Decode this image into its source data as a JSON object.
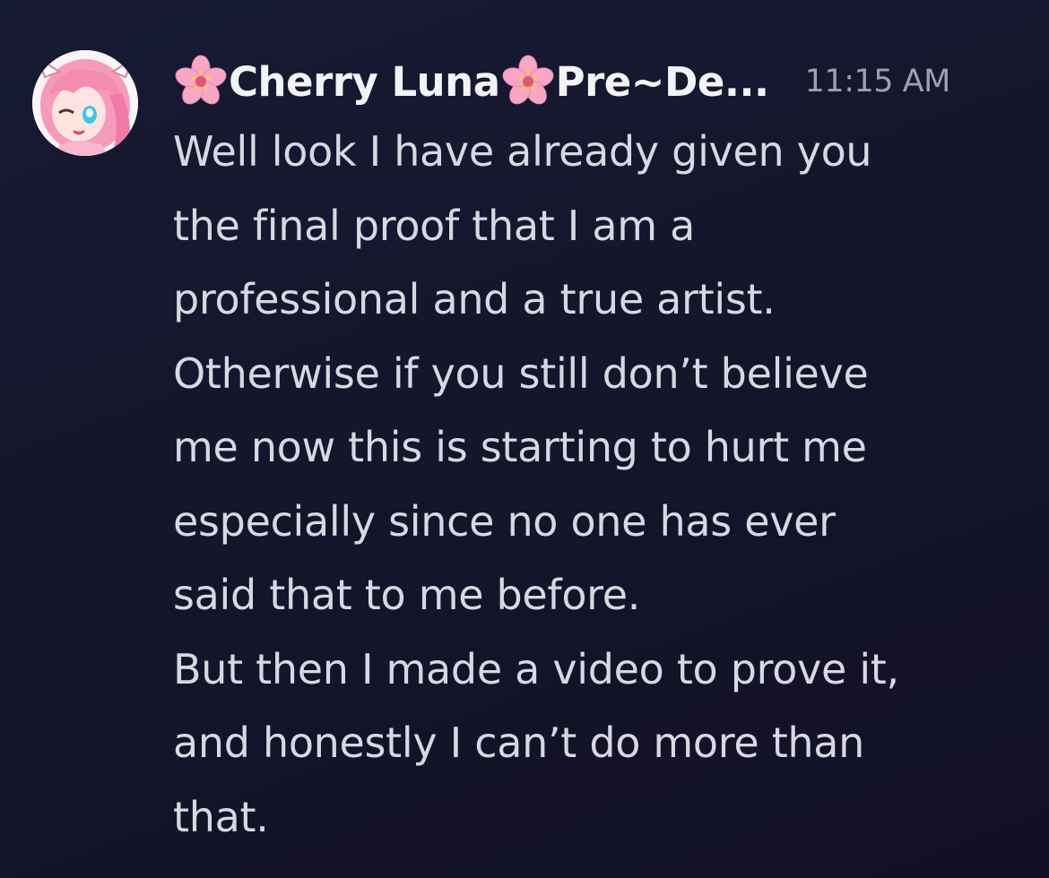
{
  "message": {
    "author": {
      "name_part1": "Cherry Luna",
      "name_part2": "Pre~De...",
      "icon_1": "cherry-blossom-icon",
      "icon_2": "cherry-blossom-icon",
      "avatar": "avatar-anime-pink-hair"
    },
    "timestamp": "11:15 AM",
    "lines": [
      "Well look I have already given you",
      "the final proof that I am a",
      "professional and a true artist.",
      "Otherwise if you still don’t believe",
      "me now this is starting to hurt me",
      "especially since no one has ever",
      "said that to me before.",
      "But then I made a video to prove it,",
      "and honestly I can’t do more than",
      "that."
    ]
  },
  "colors": {
    "background": "#15172e",
    "username": "#f3f3f7",
    "timestamp": "#9ea0ad",
    "text": "#d7d8e1",
    "blossom": "#f7a6c4"
  }
}
